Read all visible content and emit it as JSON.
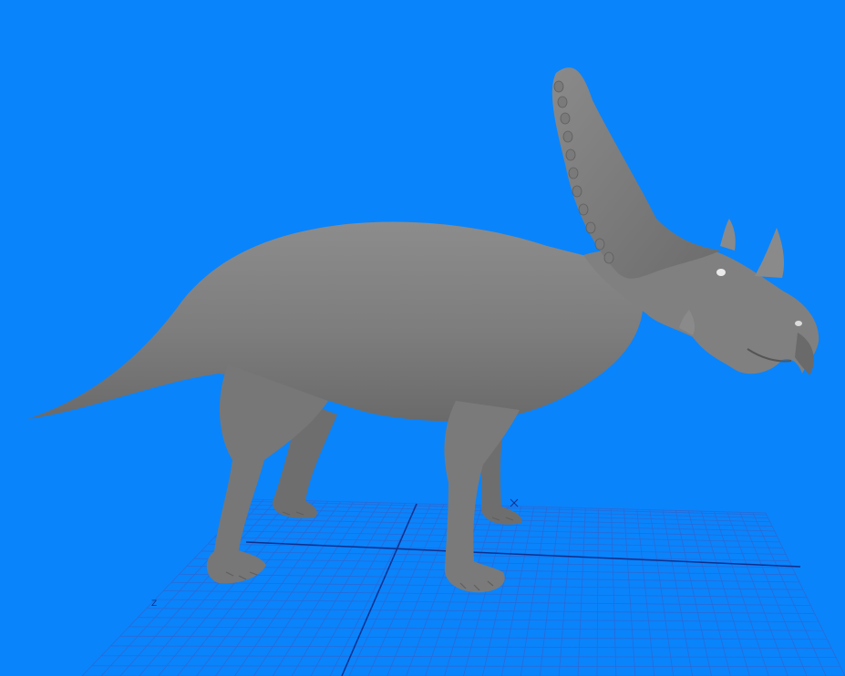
{
  "viewport": {
    "background_color": "#0a84fb",
    "view": "perspective",
    "grid": {
      "visible": true,
      "line_color": "#2a6ad6",
      "axis_color": "#0f2f8c"
    },
    "model": {
      "name": "ceratopsian-dinosaur",
      "shading": "smooth-gray",
      "base_color": "#7f7f7f"
    },
    "axis_marker": {
      "label": "Z",
      "color": "#0a2e8a"
    }
  }
}
